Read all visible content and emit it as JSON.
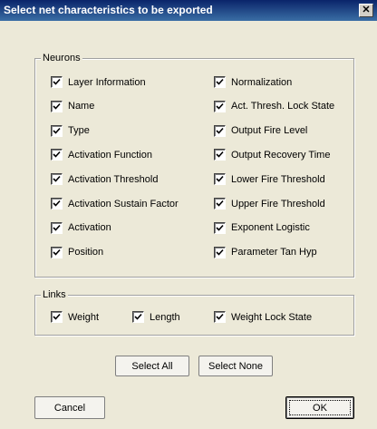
{
  "window": {
    "title": "Select net characteristics to be exported",
    "close_glyph": "✕"
  },
  "neurons": {
    "legend": "Neurons",
    "left": [
      {
        "label": "Layer Information",
        "checked": true
      },
      {
        "label": "Name",
        "checked": true
      },
      {
        "label": "Type",
        "checked": true
      },
      {
        "label": "Activation Function",
        "checked": true
      },
      {
        "label": "Activation Threshold",
        "checked": true
      },
      {
        "label": "Activation Sustain Factor",
        "checked": true
      },
      {
        "label": "Activation",
        "checked": true
      },
      {
        "label": "Position",
        "checked": true
      }
    ],
    "right": [
      {
        "label": "Normalization",
        "checked": true
      },
      {
        "label": "Act. Thresh. Lock State",
        "checked": true
      },
      {
        "label": "Output Fire Level",
        "checked": true
      },
      {
        "label": "Output Recovery Time",
        "checked": true
      },
      {
        "label": "Lower Fire Threshold",
        "checked": true
      },
      {
        "label": "Upper Fire Threshold",
        "checked": true
      },
      {
        "label": "Exponent Logistic",
        "checked": true
      },
      {
        "label": "Parameter Tan Hyp",
        "checked": true
      }
    ]
  },
  "links": {
    "legend": "Links",
    "items": [
      {
        "label": "Weight",
        "checked": true
      },
      {
        "label": "Length",
        "checked": true
      },
      {
        "label": "Weight Lock State",
        "checked": true
      }
    ]
  },
  "buttons": {
    "select_all": "Select All",
    "select_none": "Select None",
    "cancel": "Cancel",
    "ok": "OK"
  }
}
